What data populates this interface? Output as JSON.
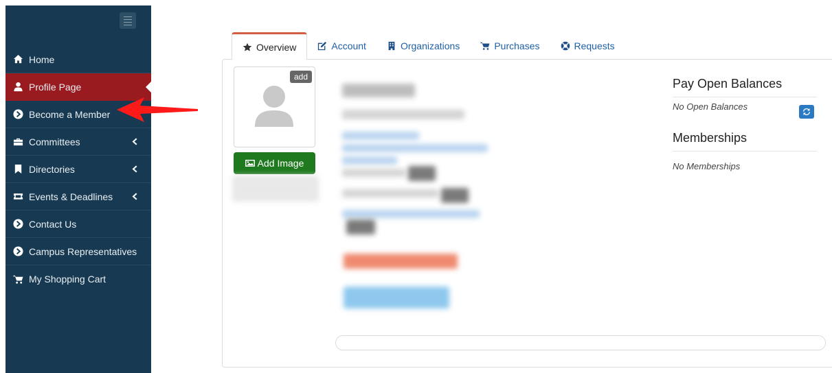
{
  "sidebar": {
    "items": [
      {
        "label": "Home",
        "icon": "home-icon",
        "active": false,
        "caret": false
      },
      {
        "label": "Profile Page",
        "icon": "user-icon",
        "active": true,
        "caret": false
      },
      {
        "label": "Become a Member",
        "icon": "chevron-circle-right-icon",
        "active": false,
        "caret": false
      },
      {
        "label": "Committees",
        "icon": "briefcase-icon",
        "active": false,
        "caret": true
      },
      {
        "label": "Directories",
        "icon": "bookmark-icon",
        "active": false,
        "caret": true
      },
      {
        "label": "Events & Deadlines",
        "icon": "ticket-icon",
        "active": false,
        "caret": true
      },
      {
        "label": "Contact Us",
        "icon": "chevron-circle-right-icon",
        "active": false,
        "caret": false
      },
      {
        "label": "Campus Representatives",
        "icon": "chevron-circle-right-icon",
        "active": false,
        "caret": false
      },
      {
        "label": "My Shopping Cart",
        "icon": "cart-icon",
        "active": false,
        "caret": false
      }
    ]
  },
  "tabs": [
    {
      "label": "Overview",
      "icon": "star-icon",
      "active": true
    },
    {
      "label": "Account",
      "icon": "edit-icon",
      "active": false
    },
    {
      "label": "Organizations",
      "icon": "building-icon",
      "active": false
    },
    {
      "label": "Purchases",
      "icon": "cart-icon",
      "active": false
    },
    {
      "label": "Requests",
      "icon": "lifebuoy-icon",
      "active": false
    }
  ],
  "profile": {
    "add_badge": "add",
    "add_image_label": "Add Image"
  },
  "right": {
    "balances_title": "Pay Open Balances",
    "balances_empty": "No Open Balances",
    "memberships_title": "Memberships",
    "memberships_empty": "No Memberships"
  },
  "colors": {
    "sidebar_bg": "#173a52",
    "active_item": "#9a1b1f",
    "link": "#1f5fa6",
    "add_image_btn": "#1f7a1f",
    "annotation_arrow": "#ff1a1a"
  }
}
